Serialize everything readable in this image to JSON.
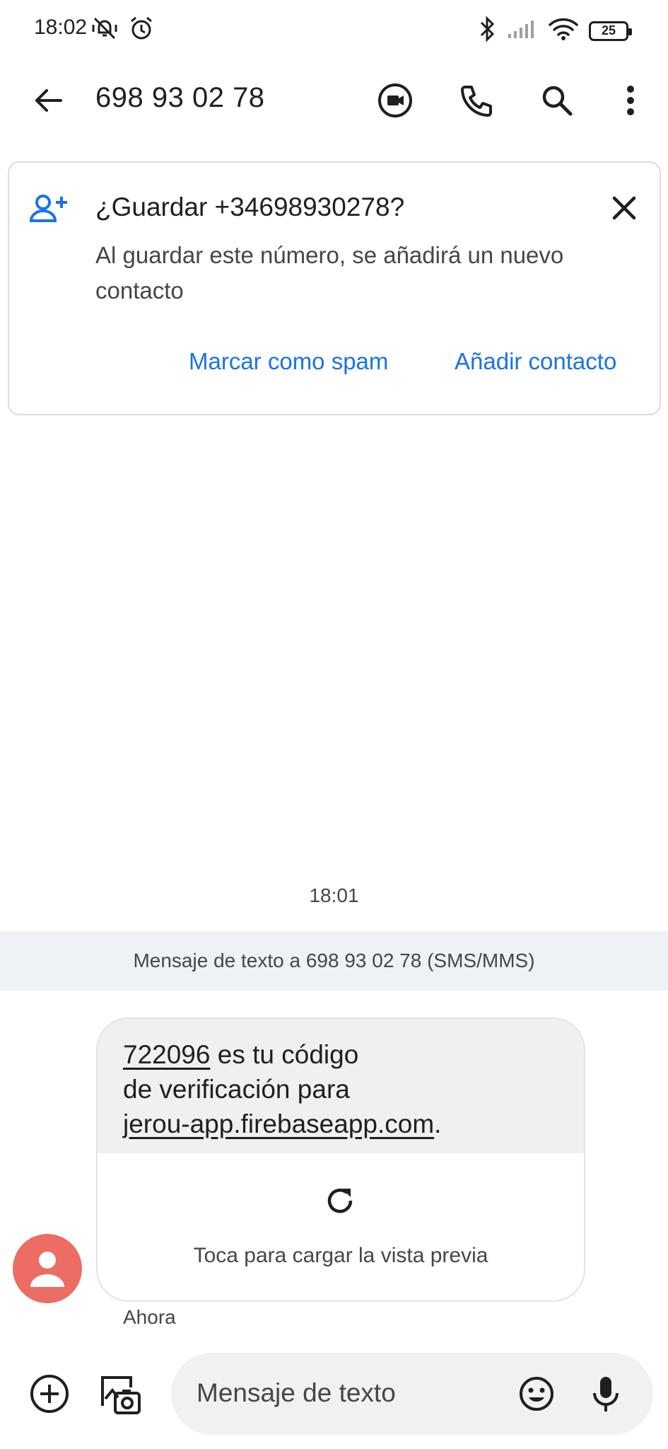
{
  "status_bar": {
    "time": "18:02",
    "battery": "25",
    "icons": [
      "mute-vibrate-icon",
      "alarm-icon",
      "bluetooth-icon",
      "signal-icon",
      "wifi-icon",
      "battery-icon"
    ]
  },
  "app_bar": {
    "title": "698 93 02 78",
    "icons": [
      "back-arrow-icon",
      "video-call-icon",
      "phone-icon",
      "search-icon",
      "more-vert-icon"
    ]
  },
  "save_card": {
    "title": "¿Guardar +34698930278?",
    "description": "Al guardar este número, se añadirá un nuevo contacto",
    "spam_label": "Marcar como spam",
    "add_label": "Añadir contacto"
  },
  "conversation": {
    "timestamp": "18:01",
    "banner": "Mensaje de texto a 698 93 02 78 (SMS/MMS)",
    "message": {
      "code": "722096",
      "line1_rest": " es tu código",
      "line2": "de verificación para",
      "link": "jerou-app.firebaseapp.com",
      "period": ".",
      "preview_label": "Toca para cargar la vista previa",
      "time": "Ahora"
    }
  },
  "compose": {
    "placeholder": "Mensaje de texto"
  },
  "colors": {
    "accent": "#1a73e8",
    "avatar": "#ec6d63",
    "banner_bg": "#eef2f7",
    "bubble_bg": "#f0f0f0",
    "compose_bg": "#eff1f3"
  }
}
